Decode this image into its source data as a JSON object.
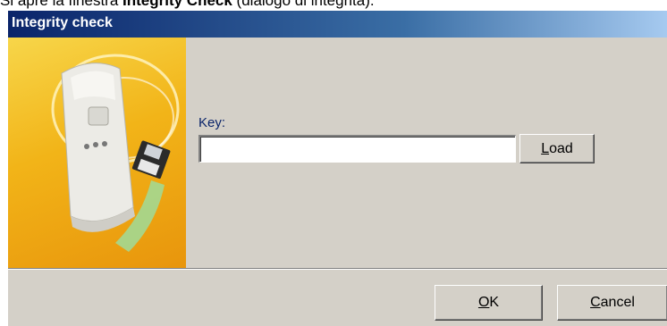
{
  "caption": {
    "prefix": "Si apre la finestra ",
    "bold": "Integrity Check",
    "suffix": " (dialogo di integrità)."
  },
  "dialog": {
    "title": "Integrity check",
    "key_label": "Key:",
    "key_value": "",
    "load_button": {
      "mnemonic": "L",
      "rest": "oad"
    },
    "ok_button": {
      "mnemonic": "O",
      "rest": "K"
    },
    "cancel_button": {
      "mnemonic": "C",
      "rest": "ancel"
    }
  },
  "colors": {
    "title_gradient_start": "#0a246a",
    "title_gradient_end": "#a6caf0",
    "dialog_face": "#d4d0c8",
    "image_background": "#f2b418"
  },
  "icons": {
    "side_image": "motion-sensor-with-floppy-disk-illustration"
  }
}
